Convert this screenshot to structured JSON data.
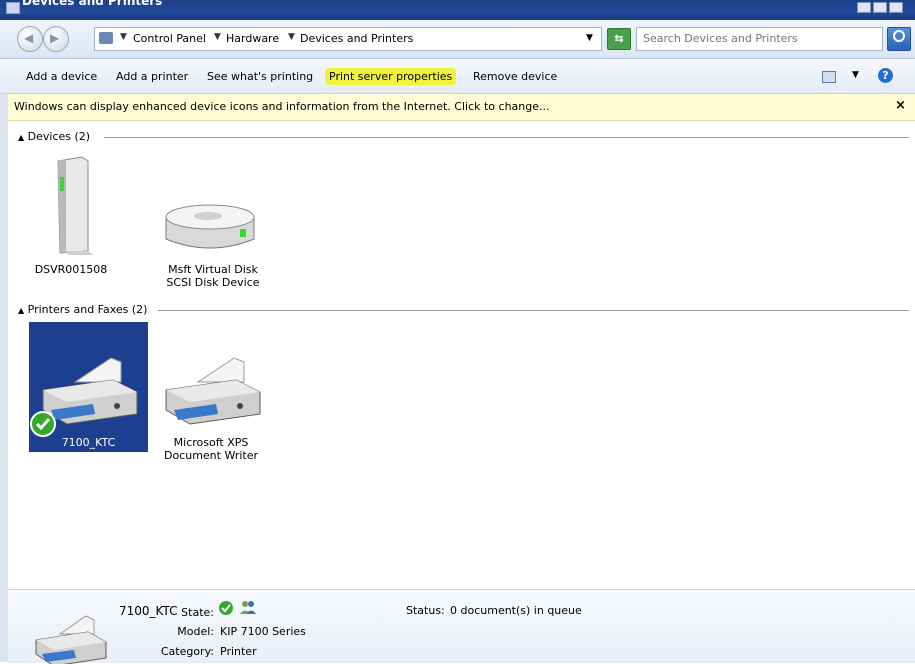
{
  "window": {
    "title": "Devices and Printers"
  },
  "address": {
    "crumbs": [
      "Control Panel",
      "Hardware",
      "Devices and Printers"
    ]
  },
  "search": {
    "placeholder": "Search Devices and Printers"
  },
  "commands": {
    "add_device": "Add a device",
    "add_printer": "Add a printer",
    "see_printing": "See what's printing",
    "print_server": "Print server properties",
    "remove_device": "Remove device",
    "highlight_color": "#f2f23a"
  },
  "infobar": {
    "text": "Windows can display enhanced device icons and information from the Internet. Click to change...",
    "close": "×"
  },
  "groups": {
    "devices": {
      "label": "Devices (2)",
      "items": [
        {
          "line1": "DSVR001508",
          "line2": "",
          "icon": "computer-icon"
        },
        {
          "line1": "Msft Virtual Disk",
          "line2": "SCSI Disk Device",
          "icon": "disk-drive-icon"
        }
      ]
    },
    "printers": {
      "label": "Printers and Faxes (2)",
      "items": [
        {
          "line1": "7100_KTC",
          "line2": "",
          "icon": "printer-icon",
          "selected": true,
          "default": true
        },
        {
          "line1": "Microsoft XPS",
          "line2": "Document Writer",
          "icon": "printer-icon"
        }
      ]
    }
  },
  "details": {
    "name": "7100_KTC",
    "state_label": "State:",
    "model_label": "Model:",
    "model_value": "KIP 7100 Series",
    "category_label": "Category:",
    "category_value": "Printer",
    "status_label": "Status:",
    "status_value": "0 document(s) in queue"
  }
}
